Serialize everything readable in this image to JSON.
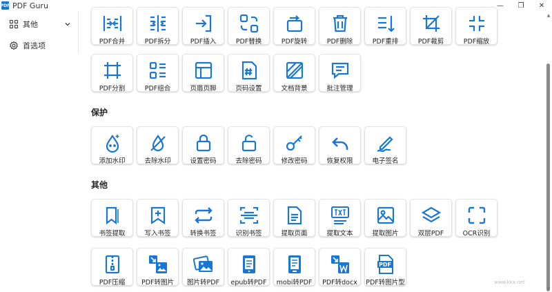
{
  "app": {
    "logo_text": "PDF",
    "title": "PDF Guru"
  },
  "window_controls": {
    "minimize": "—",
    "maximize": "❐",
    "close": "✕"
  },
  "sidebar": {
    "items": [
      {
        "label": "其他",
        "icon": "grid-icon",
        "expandable": true
      },
      {
        "label": "首选项",
        "icon": "gear-icon",
        "expandable": false
      }
    ]
  },
  "colors": {
    "accent": "#1976d2",
    "card_border": "#e3e3e3"
  },
  "sections": [
    {
      "title": "",
      "cards": [
        {
          "label": "PDF合并",
          "icon": "merge-icon"
        },
        {
          "label": "PDF拆分",
          "icon": "split-icon"
        },
        {
          "label": "PDF插入",
          "icon": "insert-icon"
        },
        {
          "label": "PDF替换",
          "icon": "replace-icon"
        },
        {
          "label": "PDF旋转",
          "icon": "rotate-icon"
        },
        {
          "label": "PDF删除",
          "icon": "trash-icon"
        },
        {
          "label": "PDF重排",
          "icon": "reorder-icon"
        },
        {
          "label": "PDF裁剪",
          "icon": "crop-icon"
        },
        {
          "label": "PDF缩放",
          "icon": "scale-icon"
        },
        {
          "label": "PDF分割",
          "icon": "grid-cut-icon"
        },
        {
          "label": "PDF组合",
          "icon": "combine-icon"
        },
        {
          "label": "页眉页脚",
          "icon": "header-footer-icon"
        },
        {
          "label": "页码设置",
          "icon": "page-number-icon"
        },
        {
          "label": "文档背景",
          "icon": "background-icon"
        },
        {
          "label": "批注管理",
          "icon": "comment-icon"
        }
      ]
    },
    {
      "title": "保护",
      "cards": [
        {
          "label": "添加水印",
          "icon": "watermark-add-icon"
        },
        {
          "label": "去除水印",
          "icon": "watermark-remove-icon"
        },
        {
          "label": "设置密码",
          "icon": "lock-icon"
        },
        {
          "label": "去除密码",
          "icon": "unlock-icon"
        },
        {
          "label": "修改密码",
          "icon": "key-icon"
        },
        {
          "label": "恢复权限",
          "icon": "undo-icon"
        },
        {
          "label": "电子签名",
          "icon": "signature-icon"
        }
      ]
    },
    {
      "title": "其他",
      "cards": [
        {
          "label": "书签提取",
          "icon": "bookmark-icon"
        },
        {
          "label": "写入书签",
          "icon": "bookmark-add-icon"
        },
        {
          "label": "转换书签",
          "icon": "convert-icon"
        },
        {
          "label": "识别书签",
          "icon": "scan-doc-icon"
        },
        {
          "label": "提取页面",
          "icon": "document-icon"
        },
        {
          "label": "提取文本",
          "icon": "text-extract-icon"
        },
        {
          "label": "提取图片",
          "icon": "image-icon"
        },
        {
          "label": "双层PDF",
          "icon": "layers-icon"
        },
        {
          "label": "OCR识别",
          "icon": "scan-frame-icon"
        },
        {
          "label": "PDF压缩",
          "icon": "zip-icon"
        },
        {
          "label": "PDF转图片",
          "icon": "pdf-to-image-icon"
        },
        {
          "label": "图片转PDF",
          "icon": "image-to-pdf-icon"
        },
        {
          "label": "epub转PDF",
          "icon": "epub-icon"
        },
        {
          "label": "mobi转PDF",
          "icon": "mobi-icon"
        },
        {
          "label": "PDF转docx",
          "icon": "word-icon"
        },
        {
          "label": "PDF转图片型",
          "icon": "pdf-file-icon"
        }
      ]
    }
  ],
  "watermark": "www.kkx.net"
}
